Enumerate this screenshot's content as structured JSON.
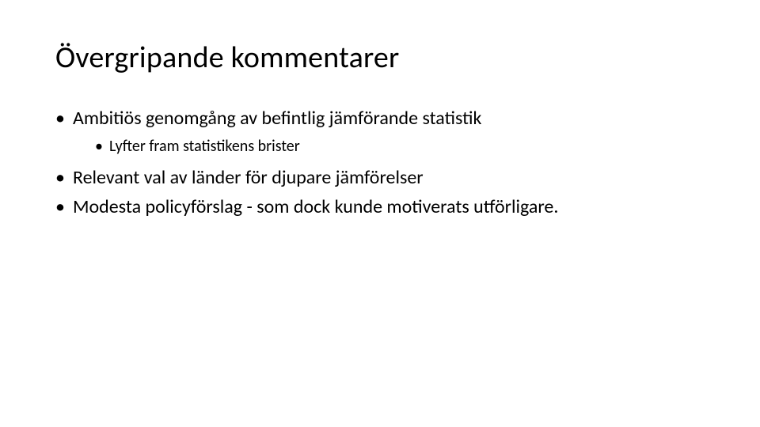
{
  "title": "Övergripande kommentarer",
  "bullets": [
    {
      "text": "Ambitiös genomgång av befintlig jämförande statistik",
      "children": [
        {
          "text": "Lyfter fram statistikens brister"
        }
      ]
    },
    {
      "text": "Relevant val av länder för djupare jämförelser",
      "children": []
    },
    {
      "text": "Modesta policyförslag - som dock kunde motiverats utförligare.",
      "children": []
    }
  ]
}
